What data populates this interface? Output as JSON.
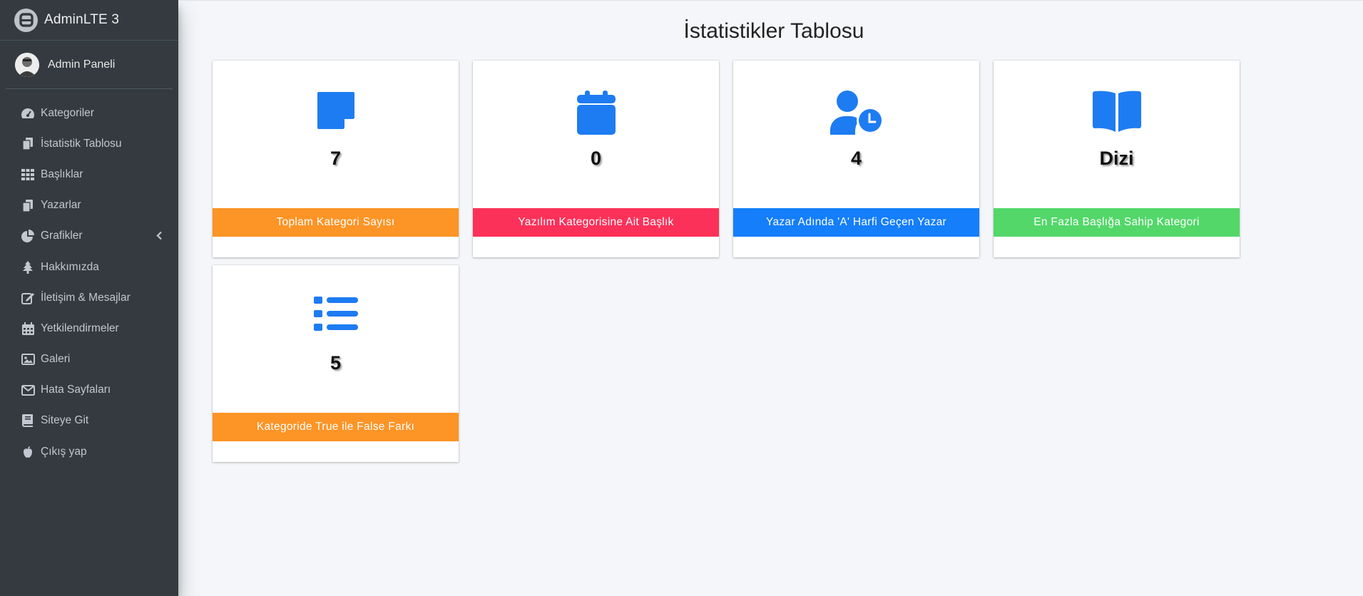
{
  "brand": {
    "title": "AdminLTE 3"
  },
  "user": {
    "name": "Admin Paneli"
  },
  "sidebar": {
    "items": [
      {
        "label": "Kategoriler",
        "icon": "tachometer-icon"
      },
      {
        "label": "İstatistik Tablosu",
        "icon": "copy-icon"
      },
      {
        "label": "Başlıklar",
        "icon": "grid-icon"
      },
      {
        "label": "Yazarlar",
        "icon": "copy-icon"
      },
      {
        "label": "Grafikler",
        "icon": "pie-chart-icon"
      },
      {
        "label": "Hakkımızda",
        "icon": "tree-icon"
      },
      {
        "label": "İletişim & Mesajlar",
        "icon": "edit-icon"
      },
      {
        "label": "Yetkilendirmeler",
        "icon": "calendar-icon"
      },
      {
        "label": "Galeri",
        "icon": "image-icon"
      },
      {
        "label": "Hata Sayfaları",
        "icon": "envelope-icon"
      },
      {
        "label": "Siteye Git",
        "icon": "book-icon"
      },
      {
        "label": "Çıkış yap",
        "icon": "apple-icon"
      }
    ]
  },
  "main": {
    "title": "İstatistikler Tablosu",
    "cards": [
      {
        "value": "7",
        "label": "Toplam Kategori Sayısı",
        "color": "#fd9426",
        "icon": "sticky-note-icon"
      },
      {
        "value": "0",
        "label": "Yazılım Kategorisine Ait Başlık",
        "color": "#fc3159",
        "icon": "calendar-icon"
      },
      {
        "value": "4",
        "label": "Yazar Adında 'A' Harfi Geçen Yazar",
        "color": "#147efb",
        "icon": "user-clock-icon"
      },
      {
        "value": "Dizi",
        "label": "En Fazla Başlığa Sahip Kategori",
        "color": "#53d769",
        "icon": "book-open-icon"
      },
      {
        "value": "5",
        "label": "Kategoride True ile False Farkı",
        "color": "#fd9426",
        "icon": "list-icon"
      }
    ]
  },
  "colors": {
    "sidebar_bg": "#343a40",
    "icon_blue": "#1e7cf2",
    "page_bg": "#f4f6f9"
  }
}
